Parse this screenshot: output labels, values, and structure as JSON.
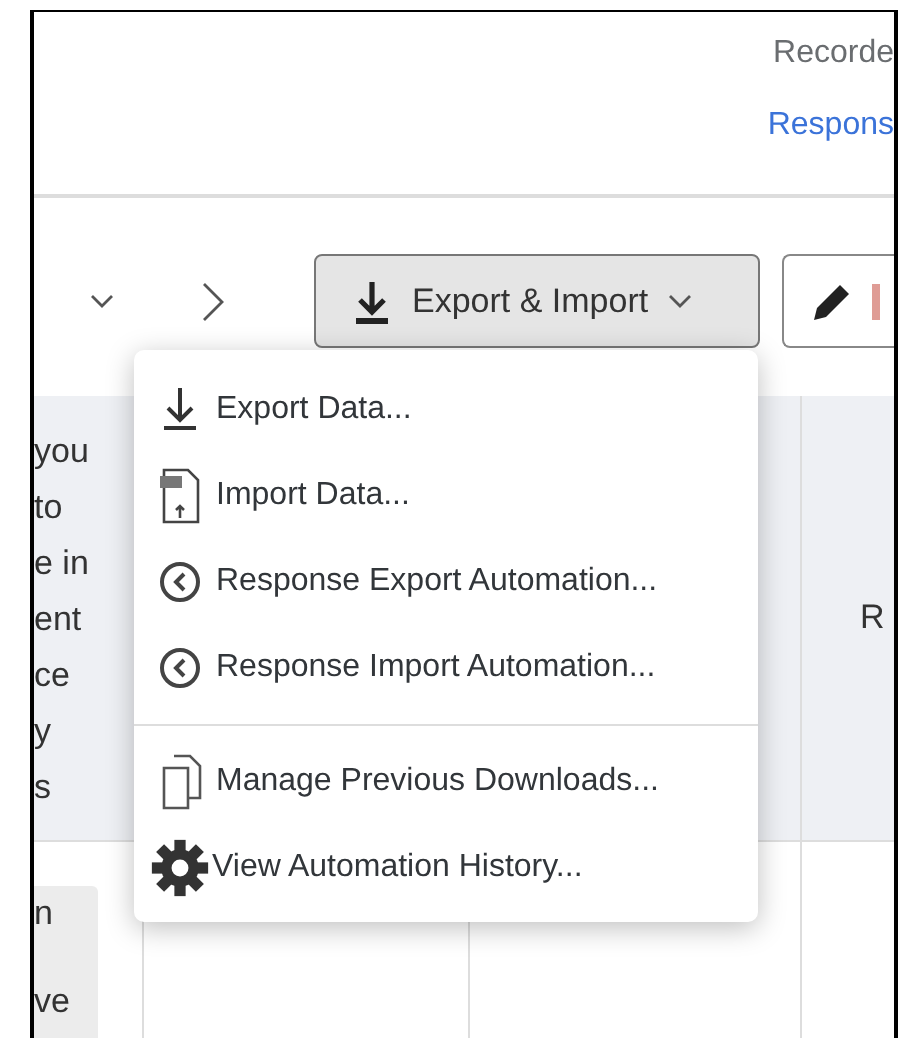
{
  "header": {
    "recorded_label": "Recorde",
    "responses_link": "Respons"
  },
  "toolbar": {
    "export_button": "Export & Import"
  },
  "menu": {
    "sections": [
      [
        {
          "kind": "download",
          "label": "Export Data..."
        },
        {
          "kind": "csv",
          "label": "Import Data..."
        },
        {
          "kind": "clock",
          "label": "Response Export Automation..."
        },
        {
          "kind": "clock",
          "label": "Response Import Automation..."
        }
      ],
      [
        {
          "kind": "files",
          "label": "Manage Previous Downloads..."
        },
        {
          "kind": "gear",
          "label": "View Automation History..."
        }
      ]
    ]
  },
  "table": {
    "column_1_lines": [
      "you",
      "to",
      "e in",
      "ent",
      "ce",
      "y",
      "s"
    ],
    "column_4": "R",
    "row_1_lines": [
      "n",
      "ve"
    ]
  }
}
